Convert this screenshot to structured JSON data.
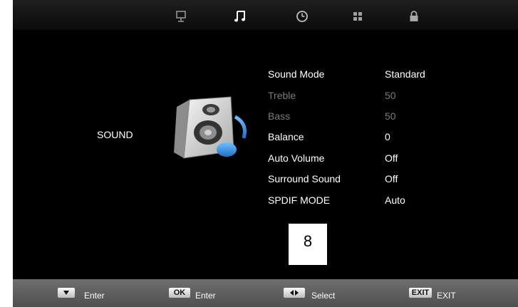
{
  "top_tabs": [
    {
      "name": "picture-tab"
    },
    {
      "name": "sound-tab",
      "active": true
    },
    {
      "name": "time-tab"
    },
    {
      "name": "setup-tab"
    },
    {
      "name": "lock-tab"
    }
  ],
  "category": {
    "label": "SOUND"
  },
  "menu": {
    "items": [
      {
        "label": "Sound Mode",
        "value": "Standard",
        "enabled": true
      },
      {
        "label": "Treble",
        "value": "50",
        "enabled": false
      },
      {
        "label": "Bass",
        "value": "50",
        "enabled": false
      },
      {
        "label": "Balance",
        "value": "0",
        "enabled": true
      },
      {
        "label": "Auto Volume",
        "value": "Off",
        "enabled": true
      },
      {
        "label": "Surround Sound",
        "value": "Off",
        "enabled": true
      },
      {
        "label": "SPDIF MODE",
        "value": "Auto",
        "enabled": true
      }
    ]
  },
  "number_box": {
    "value": "8"
  },
  "hints": {
    "down_enter": "Enter",
    "ok_key": "OK",
    "ok_enter": "Enter",
    "select": "Select",
    "exit_key": "EXIT",
    "exit": "EXIT"
  },
  "colors": {
    "active_text": "#ffffff",
    "disabled_text": "#7a7a7a",
    "accent_note": "#2f86d8"
  }
}
